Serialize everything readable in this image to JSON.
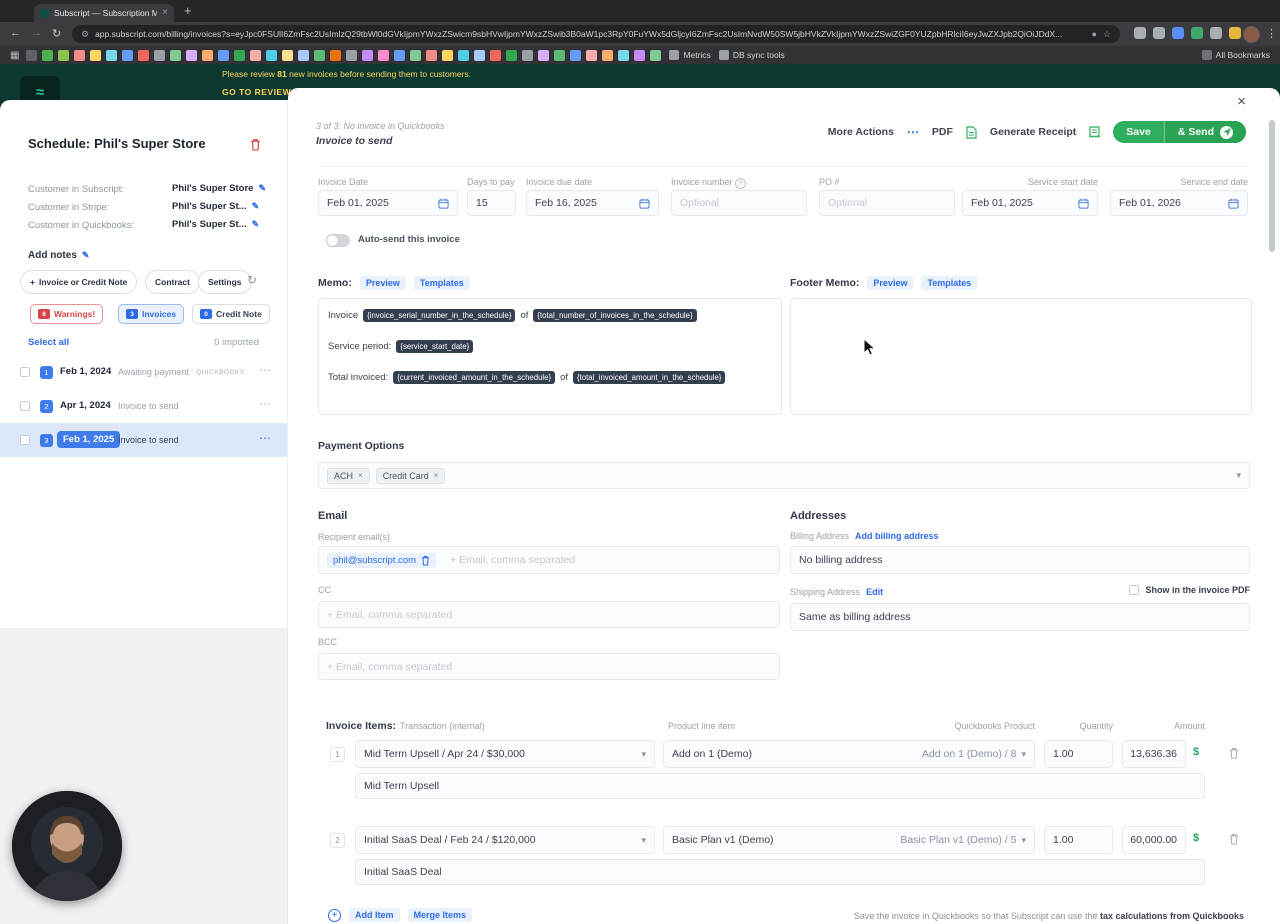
{
  "icons": {
    "close": "×",
    "remove": "×",
    "chevron_down": "▾",
    "overflow": "⋯",
    "back": "←",
    "forward": "→",
    "reload": "↻",
    "menu": "⋮",
    "star": "☆",
    "apps": "▦",
    "plus": "+",
    "pencil": "✎",
    "refresh": "↻",
    "info": "?",
    "gear": "⚙",
    "dot": "●"
  },
  "browser": {
    "tab_title": "Subscript — Subscription Ma",
    "url": "app.subscript.com/billing/invoices?s=eyJpc0FSUlI6ZmFsc2UsImlzQ29tbWl0dGVkIjpmYWxzZSwicm9sbHVwIjpmYWxzZSwib3B0aW1pc3RpY0FuYWx5dGljcyI6ZmFsc2UsImNvdW50SW5jbHVkZVkIjpmYWxzZSwiZGF0YUZpbHRlciI6eyJwZXJpb2QiOiJDdX...",
    "bookmarks": {
      "metrics": "Metrics",
      "db_tools": "DB sync tools",
      "all": "All Bookmarks"
    },
    "favicons": [
      "#5f6368",
      "#4caf50",
      "#8bc34a",
      "#f28b82",
      "#fdd663",
      "#78d9ec",
      "#669df6",
      "#ee675c",
      "#9aa0a6",
      "#81c995",
      "#d7aefb",
      "#fcad70",
      "#669df6",
      "#34a853",
      "#f6aea9",
      "#4ecde6",
      "#fde293",
      "#a8c7fa",
      "#5bb974",
      "#e8710a",
      "#9aa0a6",
      "#c58af9",
      "#ff8bcb",
      "#669df6",
      "#81c995",
      "#f28b82",
      "#fdd663",
      "#4ecde6",
      "#a8c7fa",
      "#ee675c",
      "#34a853",
      "#9aa0a6",
      "#d7aefb",
      "#5bb974",
      "#669df6",
      "#f6aea9",
      "#fcad70",
      "#78d9ec",
      "#c58af9",
      "#81c995"
    ],
    "ext_icons": [
      "#a9adb4",
      "#a9adb4",
      "#5a8df5",
      "#3fa96b",
      "#a9adb4",
      "#e2b93b"
    ]
  },
  "banner": {
    "pre": "Please review ",
    "count": "81",
    "post": " new invoices before sending them to customers.",
    "cta": "GO TO REVIEW"
  },
  "sidebar": {
    "title_label": "Schedule:",
    "title_name": "Phil's Super Store",
    "customers": [
      {
        "label": "Customer in Subscript:",
        "value": "Phil's Super Store"
      },
      {
        "label": "Customer in Stripe:",
        "value": "Phil's Super St..."
      },
      {
        "label": "Customer in Quickbooks:",
        "value": "Phil's Super St..."
      }
    ],
    "add_notes": "Add notes",
    "actions": {
      "new": "Invoice or Credit Note",
      "contract": "Contract",
      "settings": "Settings"
    },
    "tabs": [
      {
        "label": "Warnings!",
        "badge": "8"
      },
      {
        "label": "Invoices",
        "badge": "3"
      },
      {
        "label": "Credit Note",
        "badge": "0"
      }
    ],
    "select_all": "Select all",
    "imported": "0 imported",
    "invoices": [
      {
        "num": "1",
        "date": "Feb 1, 2024",
        "status": "Awaiting payment",
        "tag": "QUICKBOOKS"
      },
      {
        "num": "2",
        "date": "Apr 1, 2024",
        "status": "Invoice to send",
        "tag": ""
      },
      {
        "num": "3",
        "date": "Feb 1, 2025",
        "status": "Invoice to send",
        "tag": ""
      }
    ]
  },
  "header": {
    "subtitle": "3 of 3: No invoice in Quickbooks",
    "status": "Invoice to send",
    "more_actions": "More Actions",
    "pdf": "PDF",
    "generate_receipt": "Generate Receipt",
    "save": "Save",
    "send": "& Send"
  },
  "form": {
    "invoice_date": {
      "label": "Invoice Date",
      "value": "Feb 01, 2025"
    },
    "days_to_pay": {
      "label": "Days to pay",
      "value": "15"
    },
    "due_date": {
      "label": "Invoice due date",
      "value": "Feb 16, 2025"
    },
    "invoice_number": {
      "label": "Invoice number",
      "placeholder": "Optional"
    },
    "po": {
      "label": "PO #",
      "placeholder": "Optional"
    },
    "service_start": {
      "label": "Service start date",
      "value": "Feb 01, 2025"
    },
    "service_end": {
      "label": "Service end date",
      "value": "Feb 01, 2026"
    },
    "autosend": "Auto-send this invoice"
  },
  "memo": {
    "label": "Memo:",
    "preview": "Preview",
    "templates": "Templates",
    "line1_pre": "Invoice",
    "line1_t1": "{invoice_serial_number_in_the_schedule}",
    "line1_mid": "of",
    "line1_t2": "{total_number_of_invoices_in_the_schedule}",
    "line2_pre": "Service period:",
    "line2_t1": "{service_start_date}",
    "line3_pre": "Total invoiced:",
    "line3_t1": "{current_invoiced_amount_in_the_schedule}",
    "line3_mid": "of",
    "line3_t2": "{total_invoiced_amount_in_the_schedule}"
  },
  "footer_memo": {
    "label": "Footer Memo:",
    "preview": "Preview",
    "templates": "Templates"
  },
  "payment": {
    "label": "Payment Options",
    "chips": [
      {
        "label": "ACH"
      },
      {
        "label": "Credit Card"
      }
    ]
  },
  "email": {
    "section": "Email",
    "recipient_label": "Recipient email(s)",
    "chip": "phil@subscript.com",
    "placeholder": "+ Email, comma separated",
    "cc": "CC",
    "bcc": "BCC"
  },
  "addresses": {
    "section": "Addresses",
    "billing_label": "Billing Address",
    "add_billing": "Add billing address",
    "billing_value": "No billing address",
    "shipping_label": "Shipping Address",
    "edit": "Edit",
    "show_pdf": "Show in the invoice PDF",
    "shipping_value": "Same as billing address"
  },
  "items": {
    "section": "Invoice Items:",
    "col_transaction": "Transaction (internal)",
    "col_product": "Product line item",
    "col_qb": "Quickbooks Product",
    "col_qty": "Quantity",
    "col_amount": "Amount",
    "rows": [
      {
        "num": "1",
        "transaction": "Mid Term Upsell / Apr 24 / $30,000",
        "product": "Add on 1 (Demo)",
        "qb": "Add on 1 (Demo) / 8",
        "qty": "1.00",
        "amount": "13,636.36",
        "currency": "$",
        "description": "Mid Term Upsell"
      },
      {
        "num": "2",
        "transaction": "Initial SaaS Deal / Feb 24 / $120,000",
        "product": "Basic Plan v1 (Demo)",
        "qb": "Basic Plan v1 (Demo) / 5",
        "qty": "1.00",
        "amount": "60,000.00",
        "currency": "$",
        "description": "Initial SaaS Deal"
      }
    ],
    "add_item": "Add Item",
    "merge_items": "Merge Items",
    "note_pre": "Save the invoice in Quickbooks so that Subscript can use the ",
    "note_bold": "tax calculations from Quickbooks"
  },
  "colors": {
    "accent": "#2e6be6",
    "green": "#2fae5e",
    "red": "#d64545",
    "header_teal": "#0c382f",
    "token_bg": "#333e4f"
  }
}
